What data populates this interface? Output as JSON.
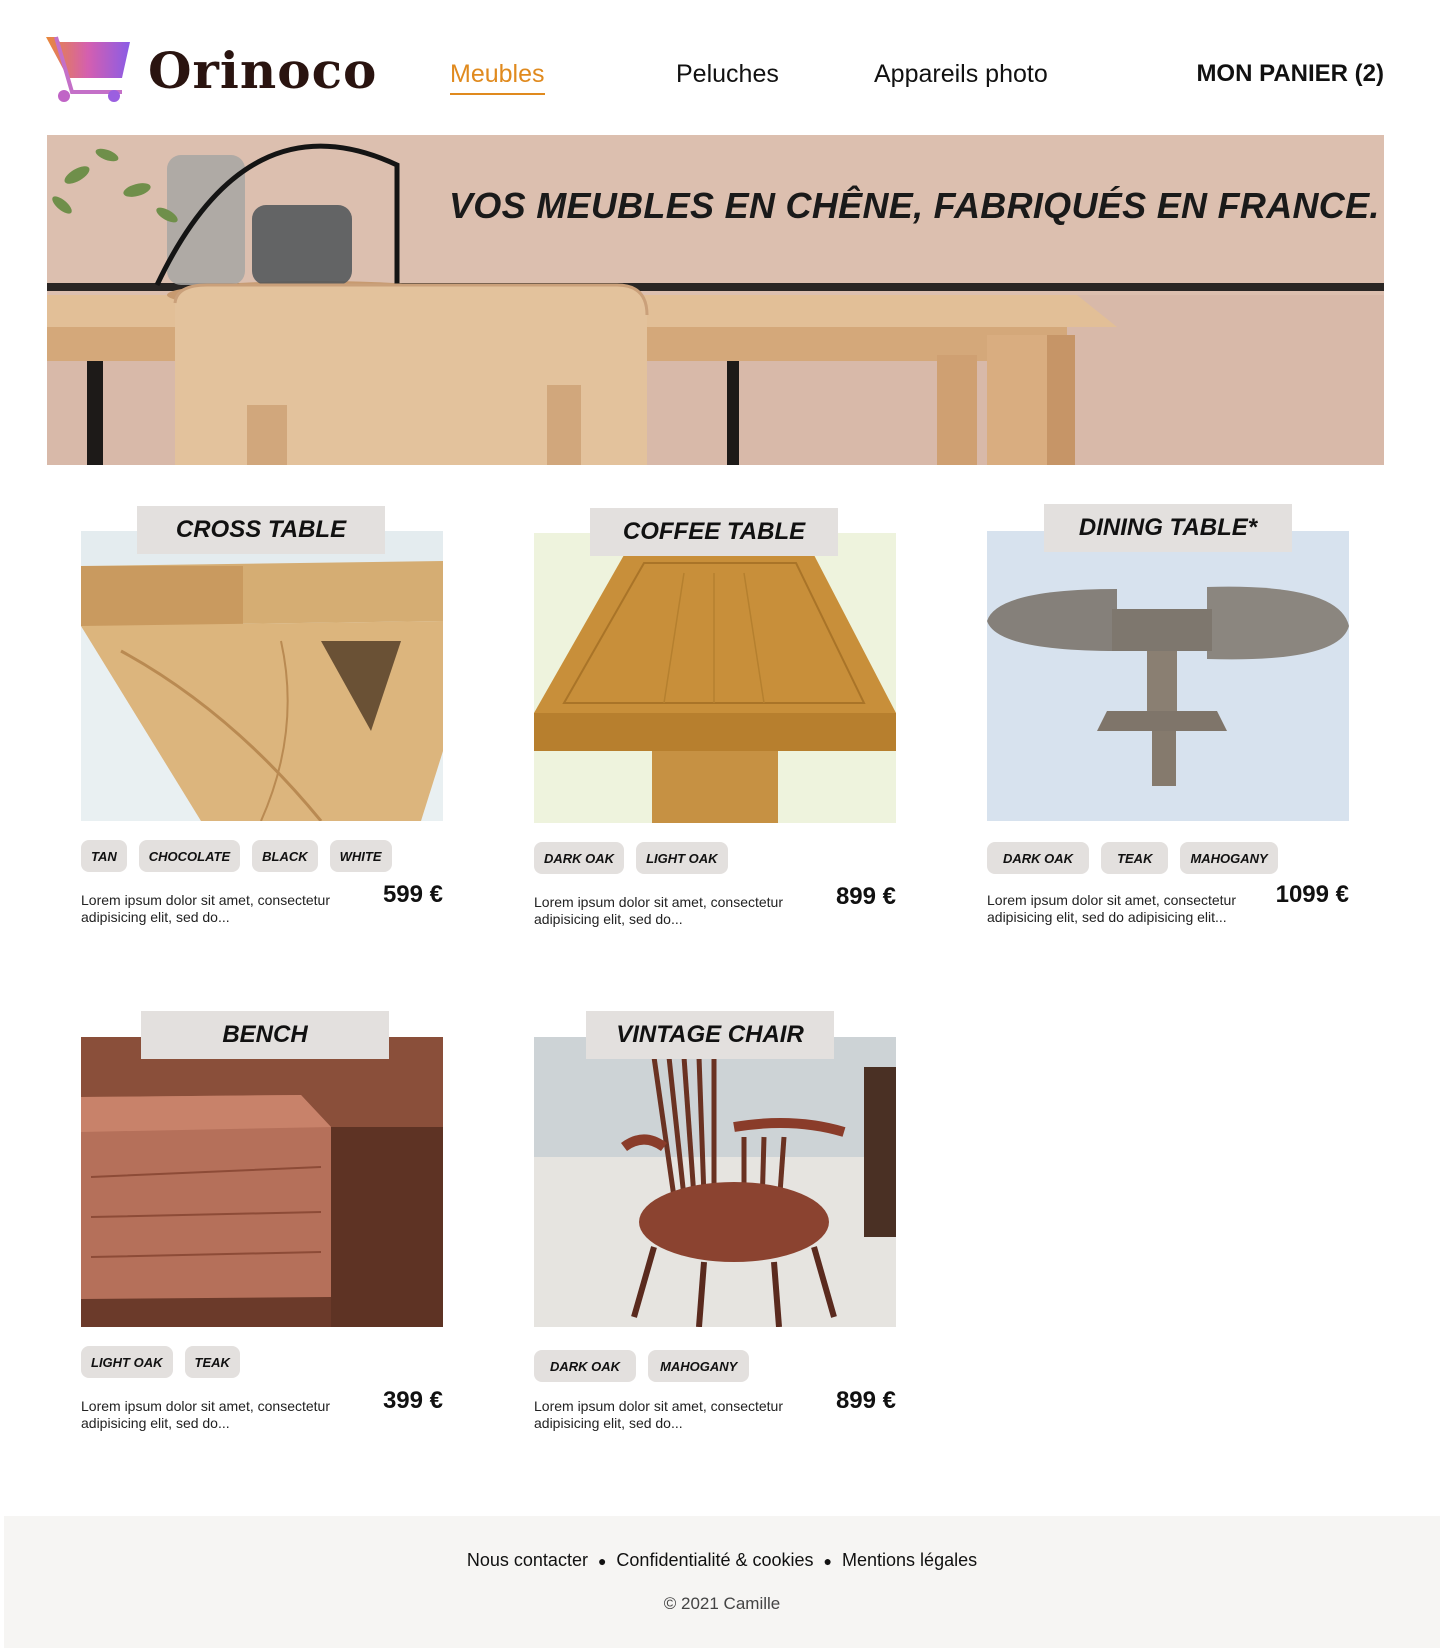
{
  "brand": {
    "name": "Orinoco"
  },
  "nav": {
    "items": [
      {
        "label": "Meubles",
        "active": true
      },
      {
        "label": "Peluches",
        "active": false
      },
      {
        "label": "Appareils photo",
        "active": false
      }
    ],
    "cart_label": "MON PANIER (2)"
  },
  "banner": {
    "title": "VOS MEUBLES EN CHÊNE, FABRIQUÉS EN FRANCE."
  },
  "products": [
    {
      "name": "CROSS TABLE",
      "tags": [
        "TAN",
        "CHOCOLATE",
        "BLACK",
        "WHITE"
      ],
      "description": "Lorem ipsum dolor sit amet, consectetur adipisicing elit, sed do...",
      "price": "599 €"
    },
    {
      "name": "COFFEE TABLE",
      "tags": [
        "DARK OAK",
        "LIGHT OAK"
      ],
      "description": "Lorem ipsum dolor sit amet, consectetur adipisicing elit, sed do...",
      "price": "899 €"
    },
    {
      "name": "DINING TABLE*",
      "tags": [
        "DARK OAK",
        "TEAK",
        "MAHOGANY"
      ],
      "description": "Lorem ipsum dolor sit amet, consectetur adipisicing elit, sed do adipisicing elit...",
      "price": "1099 €"
    },
    {
      "name": "BENCH",
      "tags": [
        "LIGHT OAK",
        "TEAK"
      ],
      "description": "Lorem ipsum dolor sit amet, consectetur adipisicing elit, sed do...",
      "price": "399 €"
    },
    {
      "name": "VINTAGE CHAIR",
      "tags": [
        "DARK OAK",
        "MAHOGANY"
      ],
      "description": "Lorem ipsum dolor sit amet, consectetur adipisicing elit, sed do...",
      "price": "899 €"
    }
  ],
  "footer": {
    "links": [
      "Nous contacter",
      "Confidentialité & cookies",
      "Mentions légales"
    ],
    "copyright": "© 2021 Camille"
  },
  "colors": {
    "accent": "#e08a1e",
    "tag_bg": "#e3e0de",
    "footer_bg": "#f6f5f3"
  }
}
